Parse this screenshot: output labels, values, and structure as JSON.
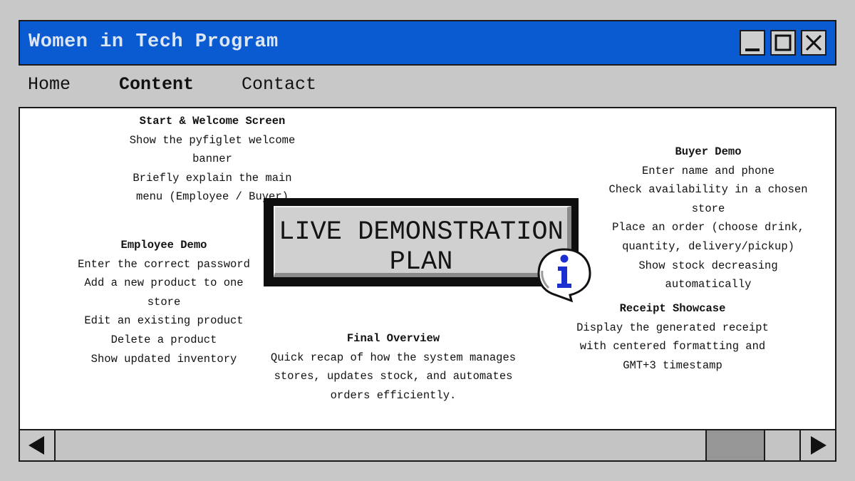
{
  "window": {
    "title": "Women in Tech Program",
    "title_color": "#0a5ad2",
    "controls": [
      "minimize-icon",
      "maximize-icon",
      "close-icon"
    ]
  },
  "nav": {
    "items": [
      {
        "label": "Home",
        "active": false
      },
      {
        "label": "Content",
        "active": true
      },
      {
        "label": "Contact",
        "active": false
      }
    ]
  },
  "banner": {
    "line1": "LIVE DEMONSTRATION",
    "line2": "PLAN",
    "icon": "info-icon"
  },
  "sections": {
    "start": {
      "heading": "Start & Welcome Screen",
      "lines": [
        "Show the pyfiglet welcome",
        "banner",
        "Briefly explain the main",
        "menu (Employee / Buyer)"
      ]
    },
    "employee": {
      "heading": "Employee Demo",
      "lines": [
        "Enter the correct password",
        "Add a new product to one",
        "store",
        "Edit an existing product",
        "Delete a product",
        "Show updated inventory"
      ]
    },
    "final": {
      "heading": "Final Overview",
      "lines": [
        "Quick recap of how the system manages",
        "stores, updates stock, and automates",
        "orders efficiently."
      ]
    },
    "buyer": {
      "heading": "Buyer Demo",
      "lines": [
        "Enter name and phone",
        "Check availability in a chosen",
        "store",
        "Place an order (choose drink,",
        "quantity, delivery/pickup)",
        "Show stock decreasing",
        "automatically"
      ]
    },
    "receipt": {
      "heading": "Receipt Showcase",
      "lines": [
        "Display the generated receipt",
        "with centered formatting and",
        "GMT+3 timestamp"
      ]
    }
  },
  "scrollbar": {
    "left_icon": "arrow-left-icon",
    "right_icon": "arrow-right-icon"
  }
}
